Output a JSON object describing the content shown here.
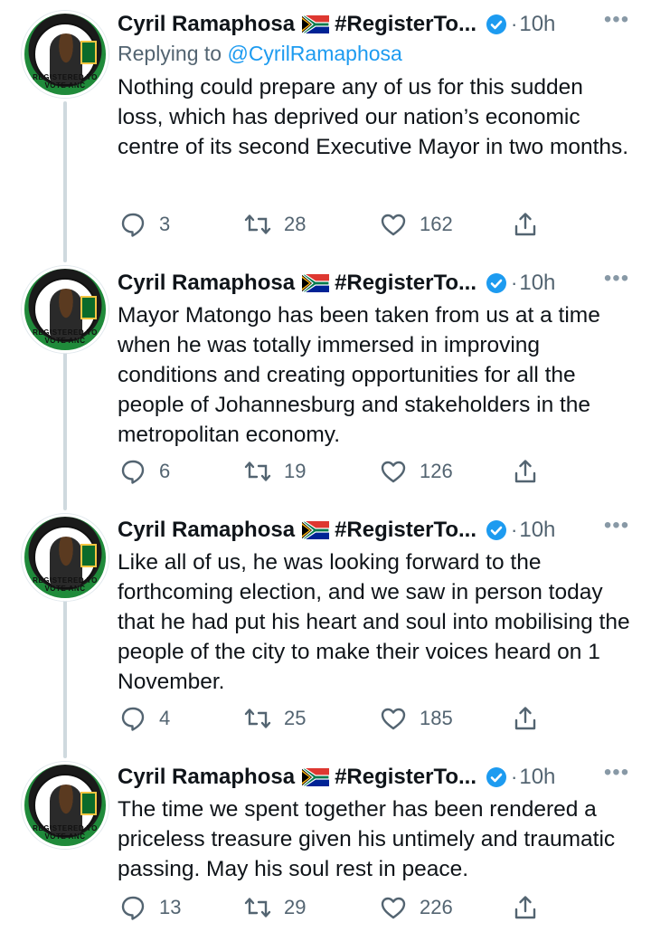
{
  "tweets": [
    {
      "author": "Cyril Ramaphosa",
      "handle_label": "#RegisterTo...",
      "time": "10h",
      "reply_prefix": "Replying to ",
      "reply_mention": "@CyrilRamaphosa",
      "text": "Nothing could prepare any of us for this sudden loss, which has deprived our nation’s economic centre of its second Executive Mayor in two months.",
      "replies": "3",
      "retweets": "28",
      "likes": "162"
    },
    {
      "author": "Cyril Ramaphosa",
      "handle_label": "#RegisterTo...",
      "time": "10h",
      "text": "Mayor Matongo has been taken from us at a time when he was totally immersed in improving conditions and creating opportunities for all the people of Johannesburg and stakeholders in the metropolitan economy.",
      "replies": "6",
      "retweets": "19",
      "likes": "126"
    },
    {
      "author": "Cyril Ramaphosa",
      "handle_label": "#RegisterTo...",
      "time": "10h",
      "text": "Like all of us, he was looking forward to the forthcoming election, and we saw in person today that he had put his heart and soul into mobilising the people of the city to make their voices heard on 1 November.",
      "replies": "4",
      "retweets": "25",
      "likes": "185"
    },
    {
      "author": "Cyril Ramaphosa",
      "handle_label": "#RegisterTo...",
      "time": "10h",
      "text": "The time we spent together has been rendered a priceless treasure given his untimely and traumatic passing. May his soul rest in peace.",
      "replies": "13",
      "retweets": "29",
      "likes": "226"
    }
  ],
  "avatar_caption": "REGISTERED TO VOTE ANC",
  "separator": "·",
  "more_label": "•••",
  "icons": {
    "reply": "speech-bubble-icon",
    "retweet": "retweet-icon",
    "like": "heart-icon",
    "share": "share-icon",
    "verified": "verified-badge-icon",
    "flag": "south-africa-flag-icon"
  },
  "colors": {
    "link": "#1d9bf0",
    "muted": "#536471",
    "thread_line": "#cfd9de"
  }
}
